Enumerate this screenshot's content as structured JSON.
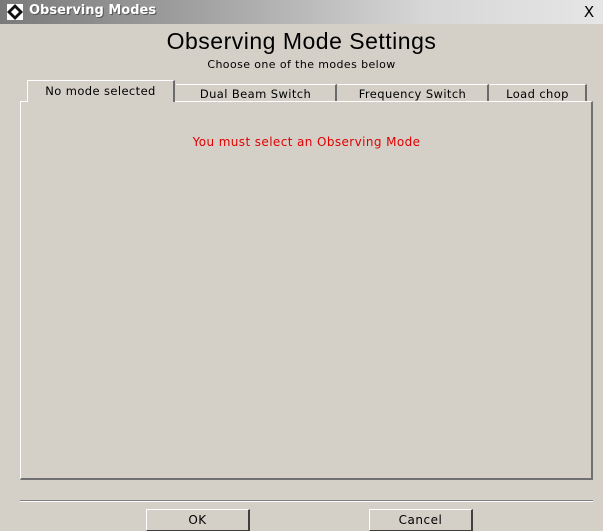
{
  "window": {
    "title": "Observing Modes",
    "close_glyph": "X",
    "icon": "diamond-app-icon"
  },
  "header": {
    "title": "Observing Mode Settings",
    "subtitle": "Choose one of the modes below"
  },
  "tabs": [
    {
      "label": "No mode selected",
      "selected": true
    },
    {
      "label": "Dual Beam Switch",
      "selected": false
    },
    {
      "label": "Frequency Switch",
      "selected": false
    },
    {
      "label": "Load chop",
      "selected": false
    }
  ],
  "panel": {
    "message": "You must select an Observing Mode",
    "message_color": "#e00000"
  },
  "buttons": {
    "ok_label": "OK",
    "cancel_label": "Cancel"
  }
}
